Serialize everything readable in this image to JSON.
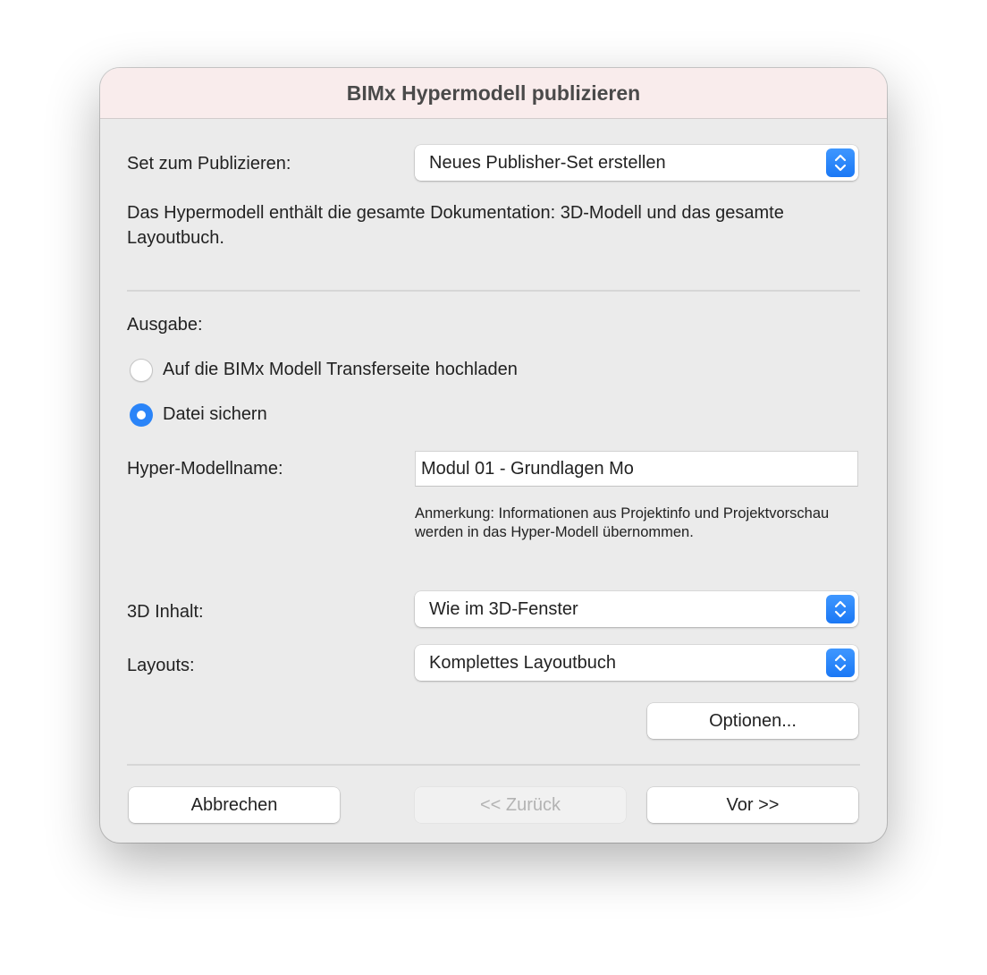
{
  "window": {
    "title": "BIMx Hypermodell publizieren"
  },
  "publish_set": {
    "label": "Set zum Publizieren:",
    "value": "Neues Publisher-Set erstellen"
  },
  "description": "Das Hypermodell enthält die gesamte Dokumentation: 3D-Modell und das gesamte Layoutbuch.",
  "output": {
    "label": "Ausgabe:",
    "options": [
      {
        "label": "Auf die BIMx Modell Transferseite hochladen",
        "selected": false
      },
      {
        "label": "Datei sichern",
        "selected": true
      }
    ]
  },
  "model_name": {
    "label": "Hyper-Modellname:",
    "value": "Modul 01 - Grundlagen Mo"
  },
  "note": "Anmerkung: Informationen aus Projektinfo und Projektvorschau werden in das Hyper-Modell übernommen.",
  "content_3d": {
    "label": "3D Inhalt:",
    "value": "Wie im 3D-Fenster"
  },
  "layouts": {
    "label": "Layouts:",
    "value": "Komplettes Layoutbuch"
  },
  "buttons": {
    "options": "Optionen...",
    "cancel": "Abbrechen",
    "back": "<< Zurück",
    "next": "Vor >>"
  },
  "colors": {
    "accent": "#2a84f8",
    "titlebar": "#f9ecec",
    "panel": "#ebebeb"
  },
  "icons": {
    "popup_indicator": "chevron-up-down-icon",
    "radio_selected": "radio-selected-icon"
  }
}
